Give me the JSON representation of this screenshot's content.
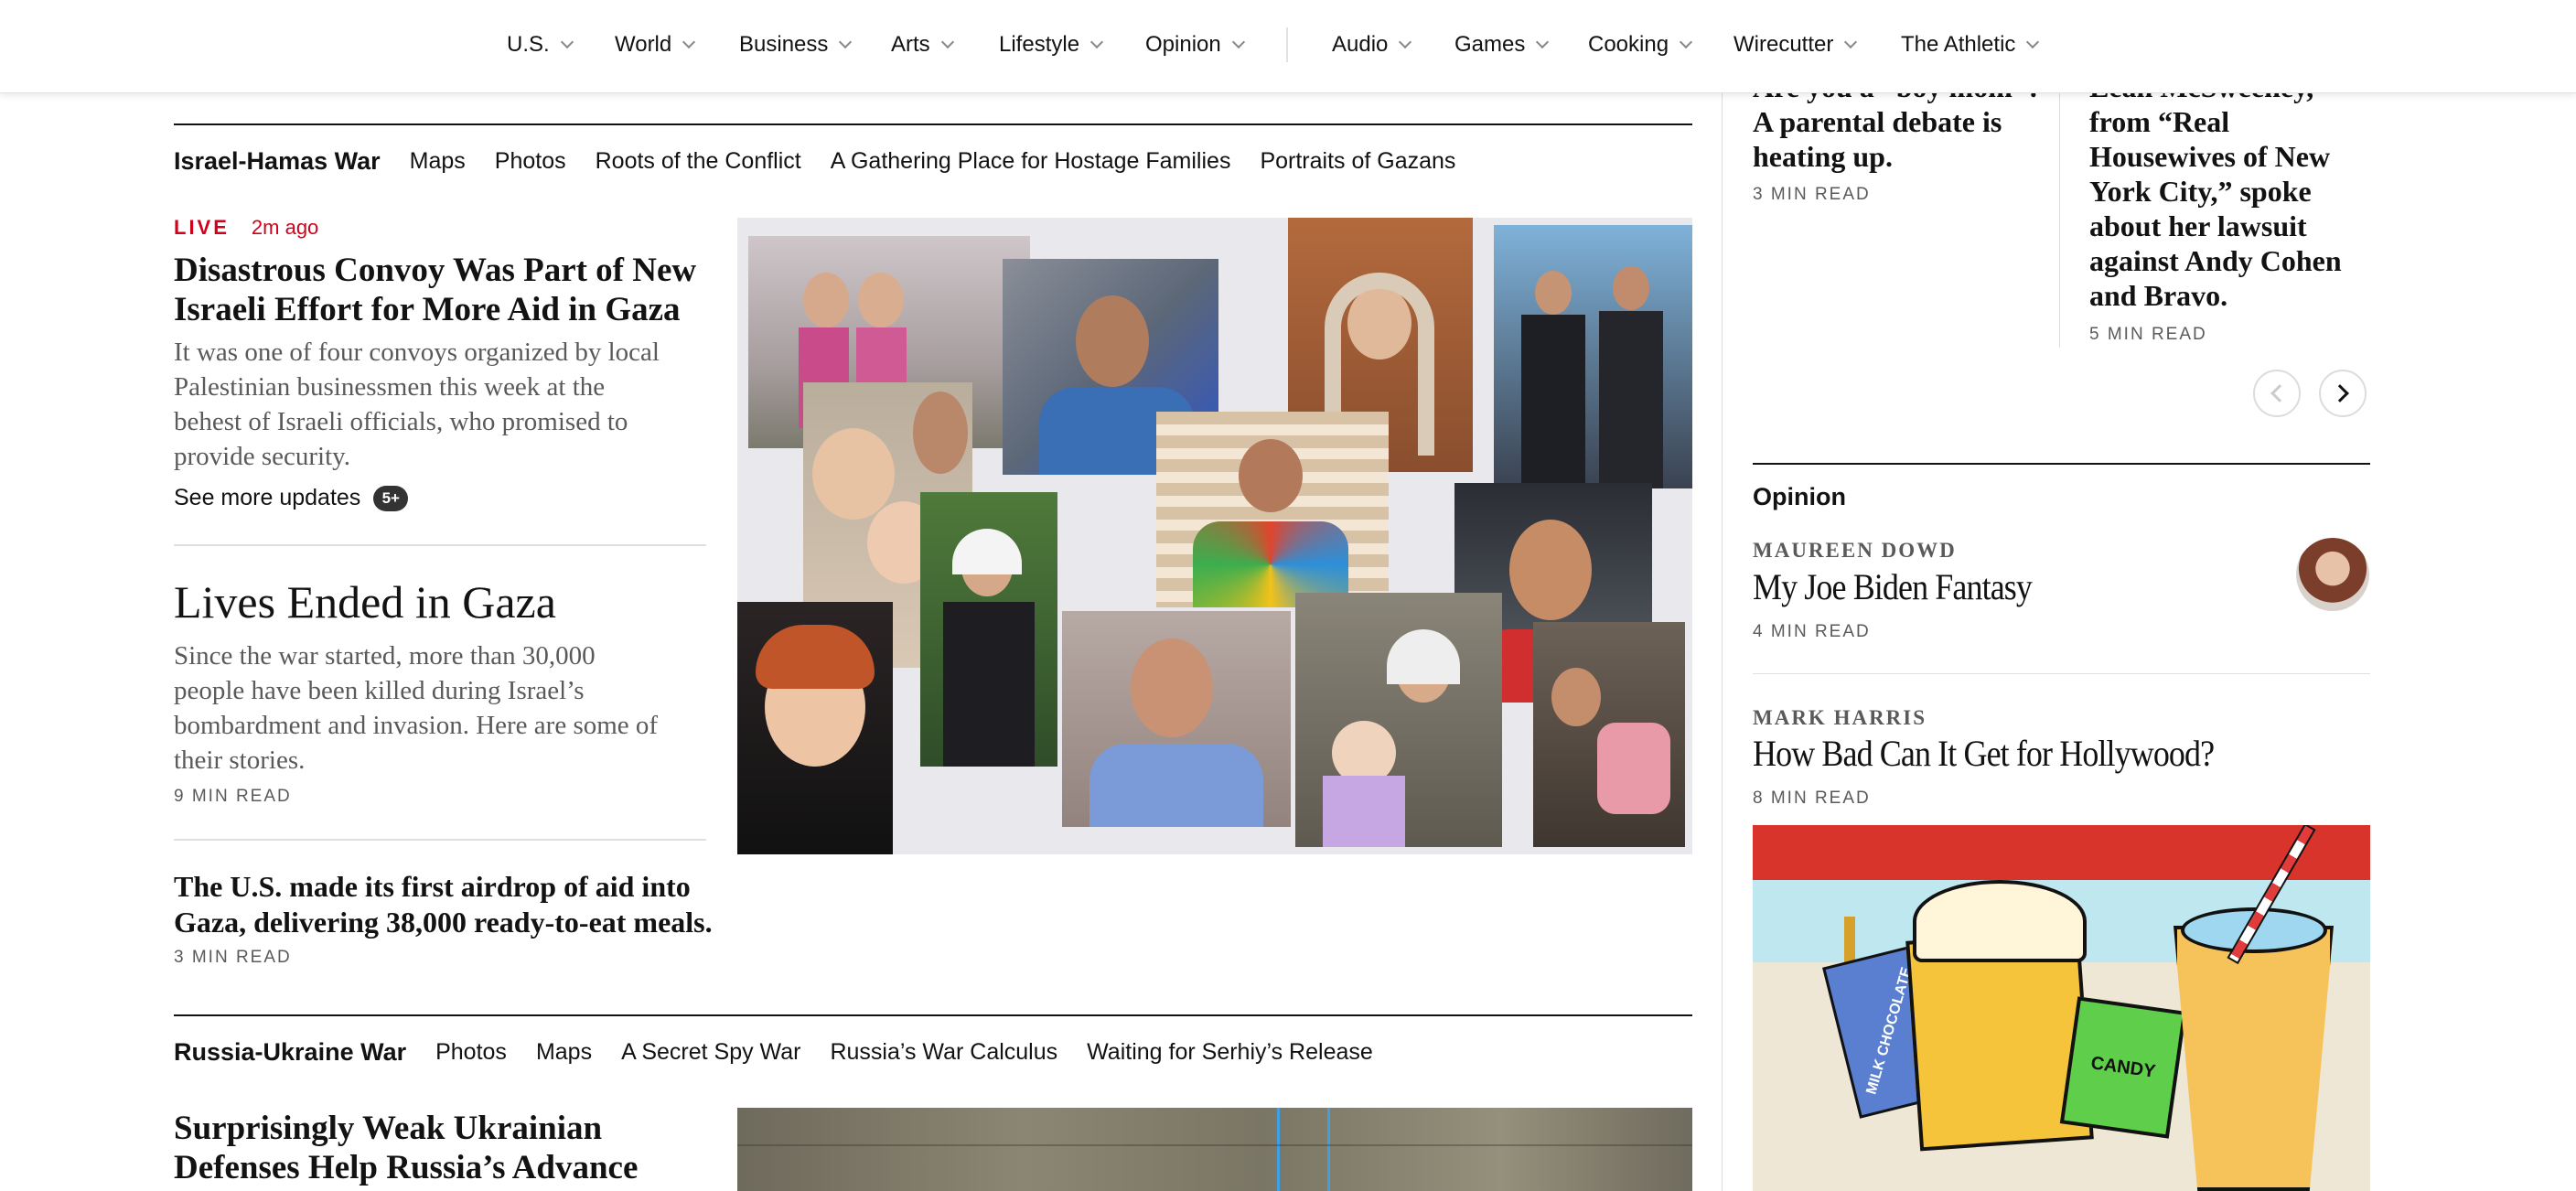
{
  "nav": {
    "items": [
      {
        "label": "U.S."
      },
      {
        "label": "World"
      },
      {
        "label": "Business"
      },
      {
        "label": "Arts"
      },
      {
        "label": "Lifestyle"
      },
      {
        "label": "Opinion"
      },
      {
        "label": "Audio"
      },
      {
        "label": "Games"
      },
      {
        "label": "Cooking"
      },
      {
        "label": "Wirecutter"
      },
      {
        "label": "The Athletic"
      }
    ]
  },
  "israel_section": {
    "title": "Israel-Hamas War",
    "links": [
      "Maps",
      "Photos",
      "Roots of the Conflict",
      "A Gathering Place for Hostage Families",
      "Portraits of Gazans"
    ]
  },
  "lead_story": {
    "live_label": "LIVE",
    "time": "2m ago",
    "headline_line1": "Disastrous Convoy Was Part of New",
    "headline_line2": "Israeli Effort for More Aid in Gaza",
    "summary_lines": [
      "It was one of four convoys organized by local",
      "Palestinian businessmen this week at the",
      "behest of Israeli officials, who promised to",
      "provide security."
    ],
    "more_updates": "See more updates",
    "badge": "5+"
  },
  "feature_story": {
    "headline": "Lives Ended in Gaza",
    "summary_lines": [
      "Since the war started, more than 30,000",
      "people have been killed during Israel’s",
      "bombardment and invasion. Here are some of",
      "their stories."
    ],
    "read_time": "9 MIN READ"
  },
  "airdrop_story": {
    "headline_line1": "The U.S. made its first airdrop of aid into",
    "headline_line2": "Gaza, delivering 38,000 ready-to-eat meals.",
    "read_time": "3 MIN READ"
  },
  "russia_section": {
    "title": "Russia-Ukraine War",
    "links": [
      "Photos",
      "Maps",
      "A Secret Spy War",
      "Russia’s War Calculus",
      "Waiting for Serhiy’s Release"
    ]
  },
  "ukraine_story": {
    "headline_line1": "Surprisingly Weak Ukrainian",
    "headline_line2": "Defenses Help Russia’s Advance"
  },
  "carousel": {
    "card1": {
      "lines": [
        "Are you a “boy mom”?",
        "A parental debate is",
        "heating up."
      ],
      "read_time": "3 MIN READ"
    },
    "card2": {
      "lines": [
        "Leah McSweeney,",
        "from “Real",
        "Housewives of New",
        "York City,” spoke",
        "about her lawsuit",
        "against Andy Cohen",
        "and Bravo."
      ],
      "read_time": "5 MIN READ"
    }
  },
  "opinion": {
    "title": "Opinion",
    "items": [
      {
        "author": "MAUREEN DOWD",
        "headline": "My Joe Biden Fantasy",
        "read_time": "4 MIN READ"
      },
      {
        "author": "MARK HARRIS",
        "headline": "How Bad Can It Get for Hollywood?",
        "read_time": "8 MIN READ"
      }
    ],
    "illustration_text": {
      "chocolate": "MILK CHOCOLATE",
      "candy": "CANDY"
    }
  },
  "colors": {
    "live_red": "#d0021b",
    "ink": "#121212",
    "gray_text": "#5a5a5a"
  }
}
